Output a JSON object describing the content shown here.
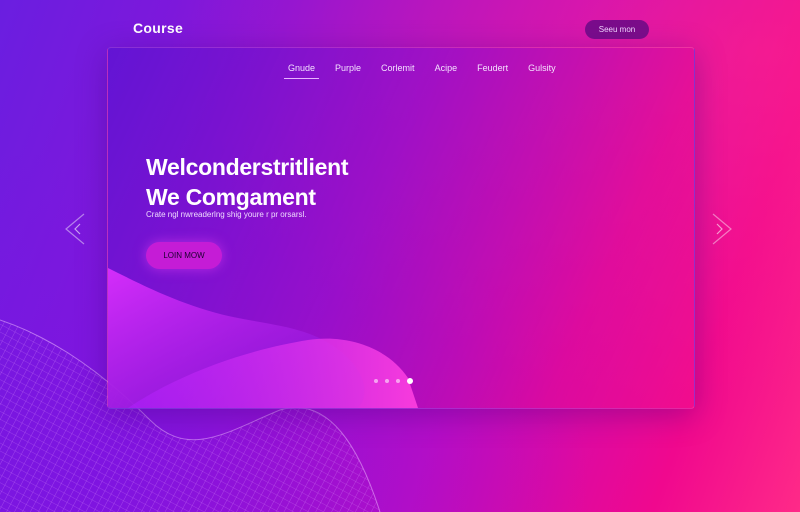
{
  "brand": {
    "logo": "Course"
  },
  "header": {
    "cta_label": "Seeu mon"
  },
  "nav": {
    "items": [
      {
        "label": "Gnude",
        "active": true
      },
      {
        "label": "Purple",
        "active": false
      },
      {
        "label": "Corlemit",
        "active": false
      },
      {
        "label": "Acipe",
        "active": false
      },
      {
        "label": "Feudert",
        "active": false
      },
      {
        "label": "Gulsity",
        "active": false
      }
    ]
  },
  "hero": {
    "title_line1": "Welconderstritlient",
    "title_line2": "We Comgament",
    "subtitle": "Crate ngl nwreaderlng shig youre r pr orsarsl.",
    "cta_label": "LOIN MOW"
  },
  "carousel": {
    "slide_count": 4,
    "active_index": 3
  },
  "colors": {
    "accent": "#c51cd6",
    "pink": "#ff2a88",
    "purple": "#6a1ee0"
  },
  "icons": {
    "prev": "chevron-left-icon",
    "next": "chevron-right-icon"
  }
}
